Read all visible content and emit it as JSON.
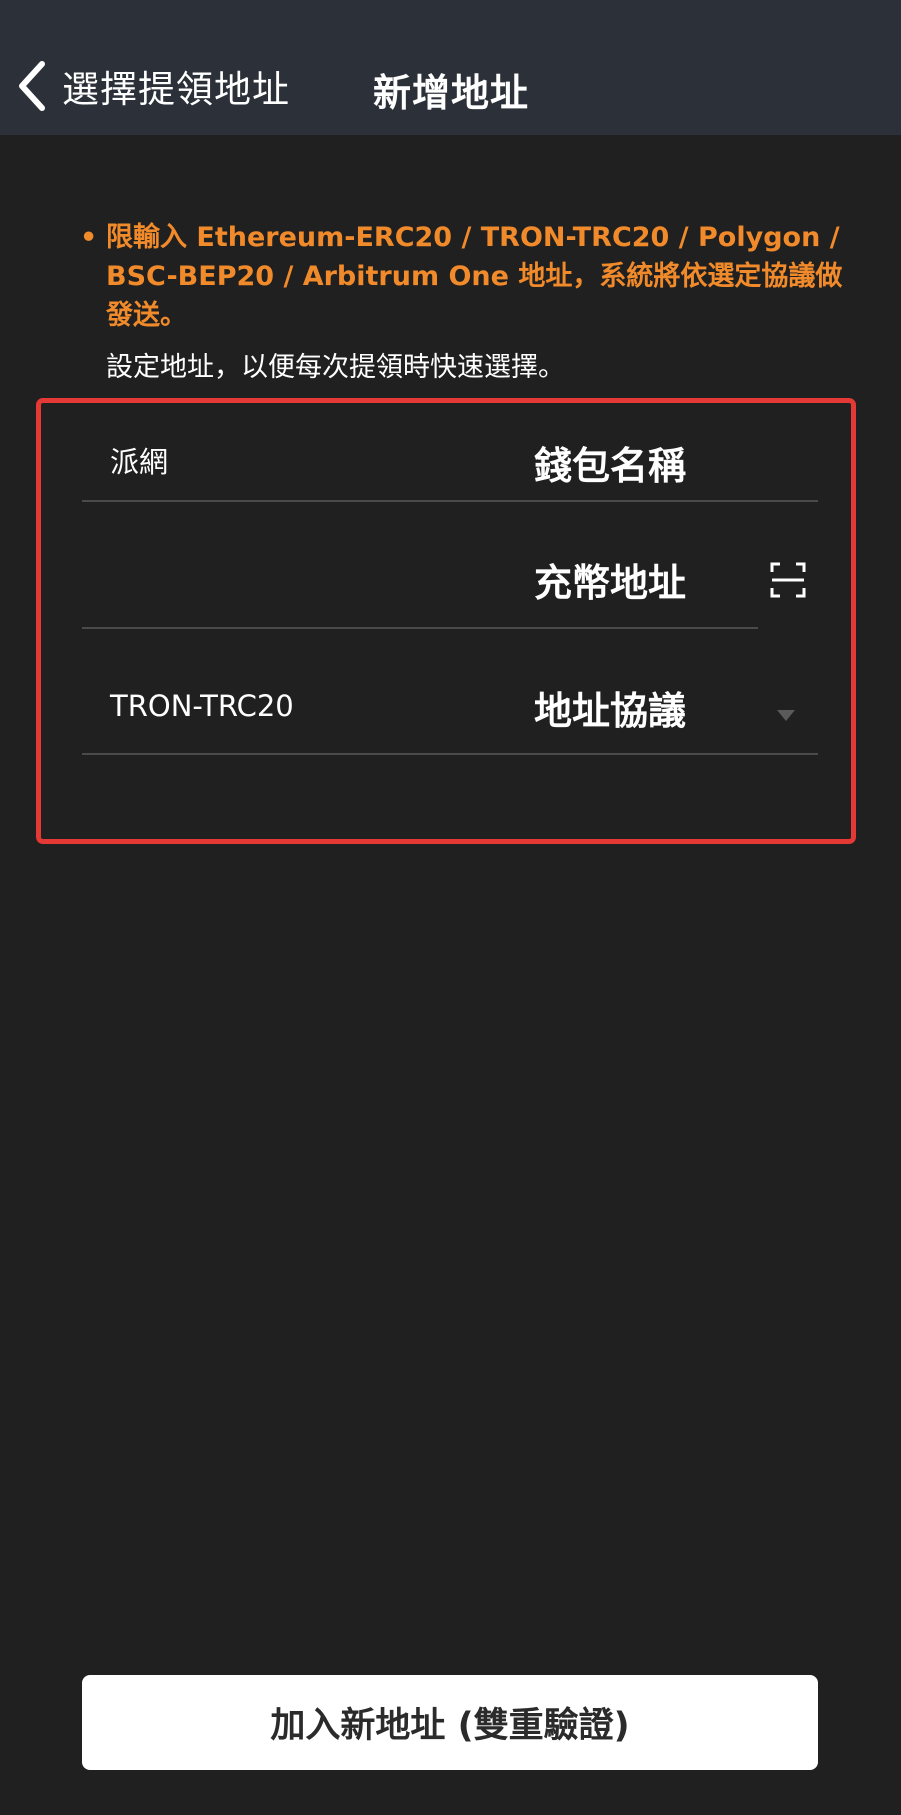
{
  "header": {
    "back_label": "選擇提領地址",
    "title": "新增地址"
  },
  "notice": {
    "bullet": "•",
    "text": "限輸入 Ethereum-ERC20 / TRON-TRC20 / Polygon / BSC-BEP20 / Arbitrum One 地址，系統將依選定協議做發送。"
  },
  "subtitle": "設定地址，以便每次提領時快速選擇。",
  "form": {
    "wallet_name": {
      "value": "派網",
      "label": "錢包名稱"
    },
    "deposit_address": {
      "value": "",
      "label": "充幣地址"
    },
    "protocol": {
      "value": "TRON-TRC20",
      "label": "地址協議"
    }
  },
  "submit_label": "加入新地址 (雙重驗證)",
  "colors": {
    "header_bg": "#2c3139",
    "page_bg": "#202020",
    "notice": "#f08a2a",
    "highlight": "#e53935"
  },
  "icons": {
    "back": "chevron-left-icon",
    "scan": "scan-icon",
    "dropdown": "caret-down-icon"
  }
}
